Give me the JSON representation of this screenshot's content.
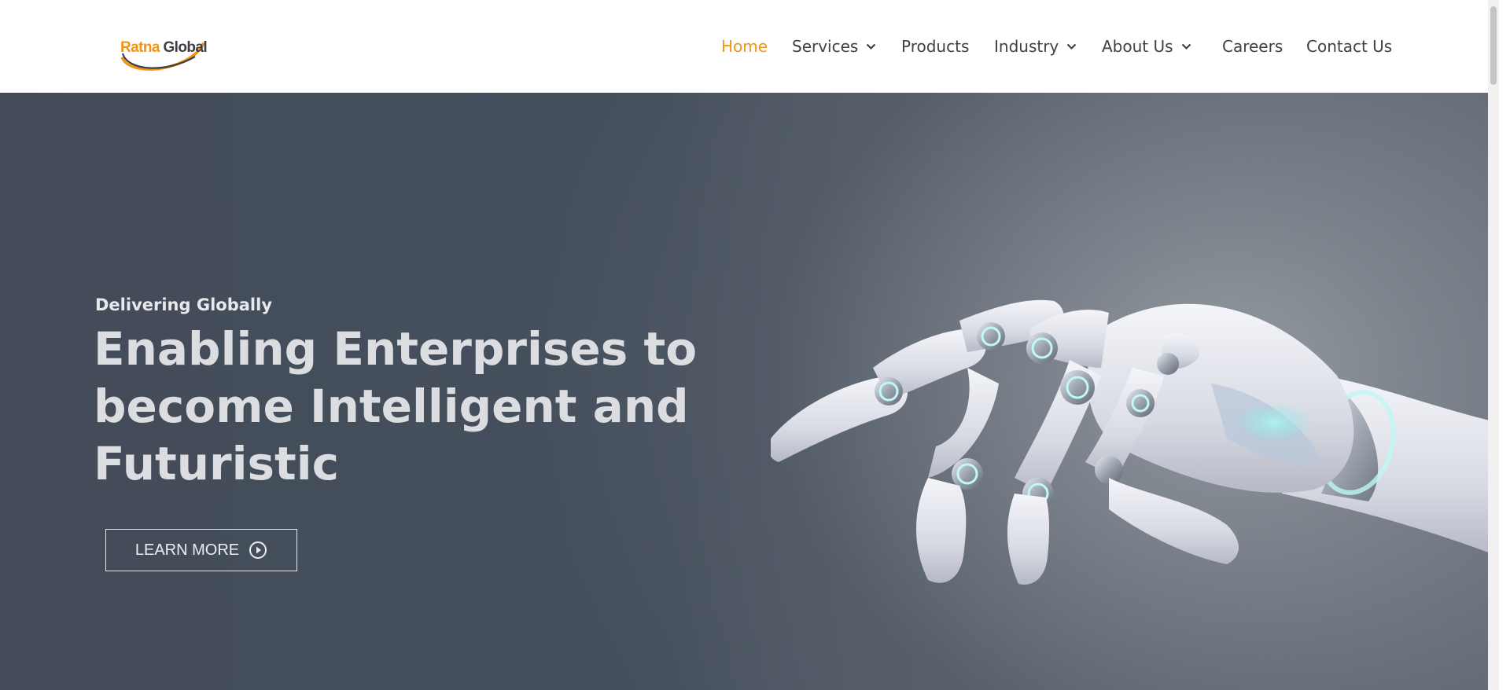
{
  "brand": {
    "name_part1": "Ratna",
    "name_part2": "Global",
    "accent": "#f39313"
  },
  "nav": {
    "items": [
      {
        "label": "Home",
        "active": true,
        "dropdown": false
      },
      {
        "label": "Services",
        "active": false,
        "dropdown": true
      },
      {
        "label": "Products",
        "active": false,
        "dropdown": false
      },
      {
        "label": "Industry",
        "active": false,
        "dropdown": true
      },
      {
        "label": "About Us",
        "active": false,
        "dropdown": true
      },
      {
        "label": "Careers",
        "active": false,
        "dropdown": false
      },
      {
        "label": "Contact Us",
        "active": false,
        "dropdown": false
      }
    ]
  },
  "hero": {
    "kicker": "Delivering Globally",
    "headline_lines": [
      "Enabling Enterprises to",
      "become Intelligent and",
      "Futuristic"
    ],
    "cta_label": "LEARN MORE",
    "cta_icon": "play-circle-icon",
    "image": "robot-hand"
  }
}
